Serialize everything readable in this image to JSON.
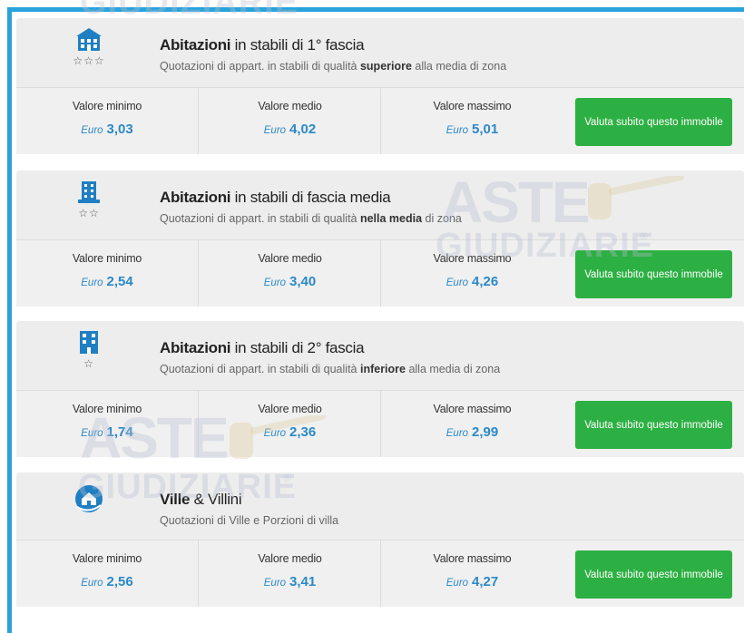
{
  "watermark": {
    "line1": "ASTE",
    "line2": "GIUDIZIARIE",
    "reg": "®"
  },
  "currency": "Euro",
  "labels": {
    "min": "Valore minimo",
    "mid": "Valore medio",
    "max": "Valore massimo"
  },
  "button_label": "Valuta subito questo immobile",
  "colors": {
    "accent": "#29a3db",
    "button": "#2db043",
    "value": "#2b89c8"
  },
  "cards": [
    {
      "icon": "building-large-icon",
      "stars": "☆☆☆",
      "title_bold": "Abitazioni",
      "title_rest": " in stabili di 1° fascia",
      "subtitle_pre": "Quotazioni di appart. in stabili di qualità ",
      "subtitle_bold": "superiore",
      "subtitle_post": " alla media di zona",
      "min": "3,03",
      "mid": "4,02",
      "max": "5,01"
    },
    {
      "icon": "building-medium-icon",
      "stars": "☆☆",
      "title_bold": "Abitazioni",
      "title_rest": " in stabili di fascia media",
      "subtitle_pre": "Quotazioni di appart. in stabili di qualità ",
      "subtitle_bold": "nella media",
      "subtitle_post": " di zona",
      "min": "2,54",
      "mid": "3,40",
      "max": "4,26"
    },
    {
      "icon": "building-small-icon",
      "stars": "☆",
      "title_bold": "Abitazioni",
      "title_rest": " in stabili di 2° fascia",
      "subtitle_pre": "Quotazioni di appart. in stabili di qualità ",
      "subtitle_bold": "inferiore",
      "subtitle_post": " alla media di zona",
      "min": "1,74",
      "mid": "2,36",
      "max": "2,99"
    },
    {
      "icon": "villa-icon",
      "stars": "",
      "title_bold": "Ville",
      "title_rest": " & Villini",
      "subtitle_pre": "Quotazioni di Ville e Porzioni di villa",
      "subtitle_bold": "",
      "subtitle_post": "",
      "min": "2,56",
      "mid": "3,41",
      "max": "4,27"
    }
  ]
}
